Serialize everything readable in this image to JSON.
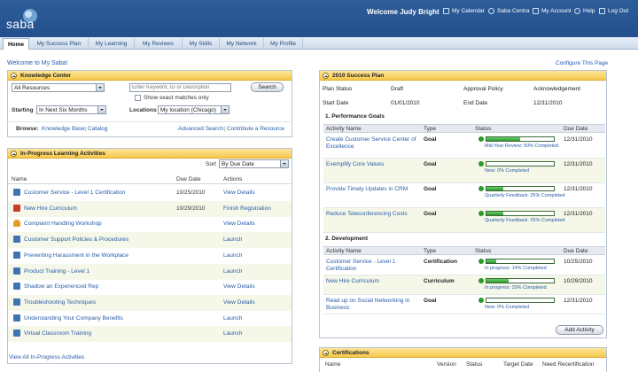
{
  "header": {
    "logo": "saba",
    "welcome": "Welcome Judy Bright",
    "links": [
      "My Calendar",
      "Saba Centra",
      "My Account",
      "Help",
      "Log Out"
    ]
  },
  "nav": {
    "tabs": [
      "Home",
      "My Success Plan",
      "My Learning",
      "My Reviews",
      "My Skills",
      "My Network",
      "My Profile"
    ]
  },
  "welcome_msg": "Welcome to My Saba!",
  "configure": "Configure This Page",
  "knowledge": {
    "title": "Knowledge Center",
    "resource_select": "All Resources",
    "search_placeholder": "Enter Keyword, ID or Description",
    "search_button": "Search",
    "exact_label": "Show exact matches only",
    "starting_label": "Starting",
    "starting_value": "In Next Six Months",
    "locations_label": "Locations",
    "locations_value": "My location (Chicago)",
    "browse_label": "Browse:",
    "browse_links": [
      "Knowledge Base",
      "Catalog"
    ],
    "sep": "|",
    "advanced_search": "Advanced Search",
    "contribute": "Contribute a Resource"
  },
  "inprogress": {
    "title": "In-Progress Learning Activities",
    "sort_label": "Sort",
    "sort_value": "By Due Date",
    "columns": [
      "Name",
      "Due Date",
      "Actions"
    ],
    "rows": [
      {
        "name": "Customer Service - Level 1 Certification",
        "due": "10/25/2010",
        "action": "View Details",
        "icon": "book"
      },
      {
        "name": "New Hire Curriculum",
        "due": "10/29/2010",
        "action": "Finish Registration",
        "icon": "pdf"
      },
      {
        "name": "Complaint Handling Workshop",
        "due": "",
        "action": "View Details",
        "icon": "people"
      },
      {
        "name": "Customer Support Policies & Procedures",
        "due": "",
        "action": "Launch",
        "icon": "book"
      },
      {
        "name": "Preventing Harassment in the Workplace",
        "due": "",
        "action": "Launch",
        "icon": "book"
      },
      {
        "name": "Product Training - Level 1",
        "due": "",
        "action": "Launch",
        "icon": "book"
      },
      {
        "name": "Shadow an Experienced Rep",
        "due": "",
        "action": "View Details",
        "icon": "book"
      },
      {
        "name": "Troubleshooting Techniques",
        "due": "",
        "action": "View Details",
        "icon": "book"
      },
      {
        "name": "Understanding Your Company Benefits",
        "due": "",
        "action": "Launch",
        "icon": "book"
      },
      {
        "name": "Virtual Classroom Training",
        "due": "",
        "action": "Launch",
        "icon": "book"
      }
    ],
    "view_all": "View All In-Progress Activities"
  },
  "success_plan": {
    "title": "2010 Success Plan",
    "plan_status_label": "Plan Status",
    "plan_status": "Draft",
    "approval_label": "Approval Policy",
    "approval": "Acknowledgement",
    "start_label": "Start Date",
    "start": "01/01/2010",
    "end_label": "End Date",
    "end": "12/31/2010",
    "columns": [
      "Activity Name",
      "Type",
      "Status",
      "Due Date"
    ],
    "goals_title": "1. Performance Goals",
    "goals": [
      {
        "name": "Create Customer Service Center of Excellence",
        "type": "Goal",
        "progress": 50,
        "status": "Mid Year Review: 50% Completed",
        "due": "12/31/2010"
      },
      {
        "name": "Exemplify Core Values",
        "type": "Goal",
        "progress": 0,
        "status": "New: 0% Completed",
        "due": "12/31/2010"
      },
      {
        "name": "Provide Timely Updates in CRM",
        "type": "Goal",
        "progress": 25,
        "status": "Quarterly Feedback: 25% Completed",
        "due": "12/31/2010"
      },
      {
        "name": "Reduce Teleconferencing Costs",
        "type": "Goal",
        "progress": 25,
        "status": "Quarterly Feedback: 25% Completed",
        "due": "12/31/2010"
      }
    ],
    "dev_title": "2. Development",
    "dev": [
      {
        "name": "Customer Service - Level 1 Certification",
        "type": "Certification",
        "progress": 14,
        "status": "In progress: 14% Completed",
        "due": "10/25/2010"
      },
      {
        "name": "New Hire Curriculum",
        "type": "Curriculum",
        "progress": 33,
        "status": "In progress: 33% Completed",
        "due": "10/29/2010"
      },
      {
        "name": "Read up on Social Networking in Business",
        "type": "Goal",
        "progress": 0,
        "status": "New: 0% Completed",
        "due": "12/31/2010"
      }
    ],
    "add_activity": "Add Activity"
  },
  "certifications": {
    "title": "Certifications",
    "columns": [
      "Name",
      "Version",
      "Status",
      "Target Date",
      "Need Recertification"
    ]
  }
}
